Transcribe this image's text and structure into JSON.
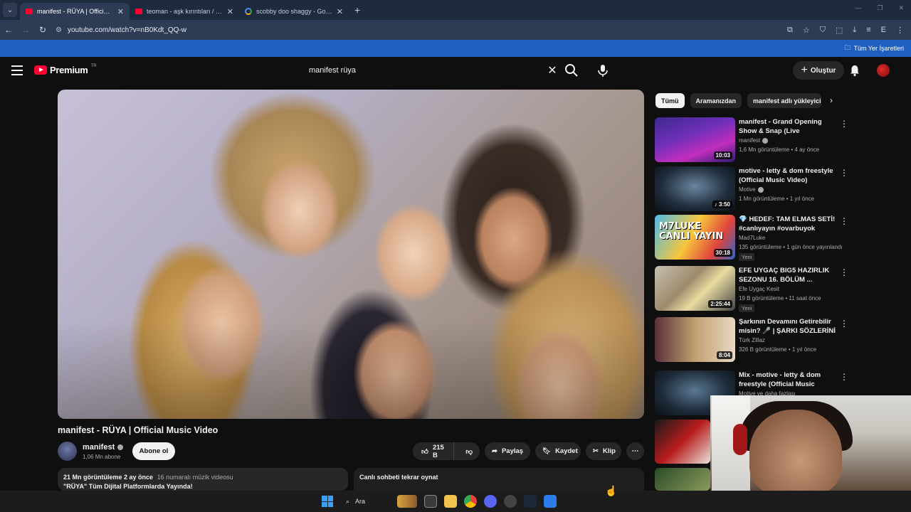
{
  "browser": {
    "tabs": [
      {
        "title": "manifest - RÜYA | Official Music Video",
        "favicon": "youtube-icon",
        "active": true
      },
      {
        "title": "teoman - aşk kırıntıları / canlı söylüyor",
        "favicon": "youtube-icon",
        "active": false
      },
      {
        "title": "scobby doo shaggy - Google'da Ara",
        "favicon": "google-icon",
        "active": false
      }
    ],
    "url": "youtube.com/watch?v=nB0Kdt_QQ-w",
    "bookmarks_label": "Tüm Yer İşaretleri"
  },
  "header": {
    "logo_text": "Premium",
    "region": "TR",
    "search_value": "manifest rüya",
    "create_label": "Oluştur"
  },
  "video": {
    "title": "manifest - RÜYA | Official Music Video",
    "channel": "manifest",
    "subscribers": "1,06 Mn abone",
    "subscribe_label": "Abone ol",
    "likes": "215 B",
    "share_label": "Paylaş",
    "save_label": "Kaydet",
    "clip_label": "Klip",
    "description": {
      "views": "21 Mn görüntüleme",
      "age": "2 ay önce",
      "tag": "16 numaralı müzik videosu",
      "line": "\"RÜYA\" Tüm Dijital Platformlarda Yayında!"
    },
    "chat_replay_label": "Canlı sohbeti tekrar oynat"
  },
  "chips": [
    "Tümü",
    "Aramanızdan",
    "manifest adlı yükleyiciden"
  ],
  "recommendations": [
    {
      "title": "manifest - Grand Opening Show & Snap (Live Performance) ...",
      "channel": "manifest",
      "verified": true,
      "meta": "1,6 Mn görüntüleme • 4 ay önce",
      "duration": "10:03",
      "new": ""
    },
    {
      "title": "motive - letty & dom freestyle (Official Music Video)",
      "channel": "Motive",
      "verified": true,
      "meta": "1 Mn görüntüleme • 1 yıl önce",
      "duration": "♪ 3:50",
      "new": ""
    },
    {
      "title": "💎 HEDEF: TAM ELMAS SETİ! #canlıyayın #ovarbuyok",
      "channel": "Mad7Luke",
      "verified": false,
      "meta": "135 görüntüleme • 1 gün önce yayınlandı",
      "duration": "30:18",
      "new": "Yeni"
    },
    {
      "title": "EFE UYGAÇ BIG5 HAZIRLIK SEZONU 16. BÖLÜM ...",
      "channel": "Efe Uygaç Kesit",
      "verified": false,
      "meta": "19 B görüntüleme • 11 saat önce",
      "duration": "2:25:44",
      "new": "Yeni"
    },
    {
      "title": "Şarkının Devamını Getirebilir misin? 🎤 | ŞARKI SÖZLERİNİ ...",
      "channel": "Türk Zillaz",
      "verified": false,
      "meta": "326 B görüntüleme • 1 yıl önce",
      "duration": "8:04",
      "new": ""
    },
    {
      "title": "Mix - motive - letty & dom freestyle (Official Music Video)",
      "channel": "Motive ve daha fazlası",
      "verified": false,
      "meta": "",
      "duration": "",
      "new": ""
    }
  ],
  "thumb3_text": "M7LUKE CANLI YAYIN",
  "taskbar": {
    "search_label": "Ara"
  }
}
